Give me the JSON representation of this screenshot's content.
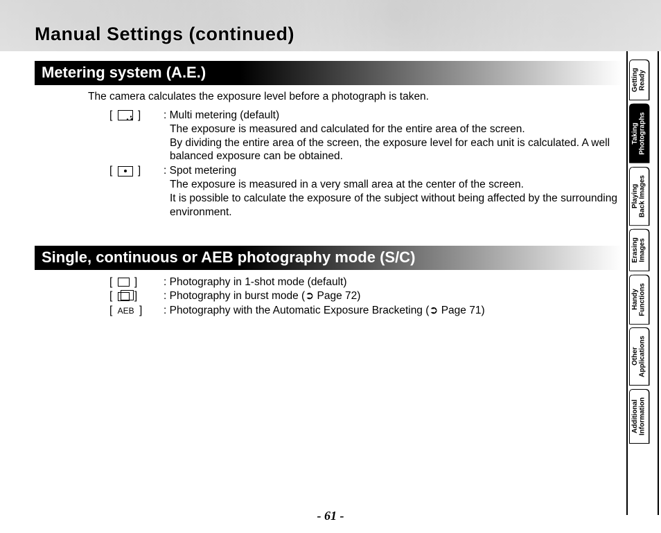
{
  "title": "Manual Settings (continued)",
  "section1": {
    "header": "Metering system (A.E.)",
    "intro": "The camera calculates the exposure level before a photograph is taken.",
    "items": [
      {
        "term": ": Multi metering (default)",
        "l1": "The exposure is measured and calculated for the entire area of the screen.",
        "l2": "By dividing the entire area of the screen, the exposure level for each unit is calculated. A well balanced exposure can be obtained."
      },
      {
        "term": ": Spot metering",
        "l1": "The exposure is measured in a very small area at the center of the screen.",
        "l2": "It is possible to calculate the exposure of the subject without being affected by the surrounding environment."
      }
    ]
  },
  "section2": {
    "header": "Single, continuous or AEB photography mode (S/C)",
    "items": [
      {
        "text": ": Photography in 1-shot mode (default)"
      },
      {
        "text": ": Photography in burst mode (➲ Page 72)"
      },
      {
        "label": "AEB",
        "text": ": Photography with the Automatic Exposure Bracketing (➲ Page 71)"
      }
    ]
  },
  "tabs": [
    {
      "label": "Getting\nReady"
    },
    {
      "label": "Taking\nPhotographs",
      "active": true
    },
    {
      "label": "Playing\nBack Images"
    },
    {
      "label": "Erasing\nImages"
    },
    {
      "label": "Handy\nFunctions"
    },
    {
      "label": "Other\nApplications"
    },
    {
      "label": "Additional\nInformation"
    }
  ],
  "pageNumber": "- 61 -"
}
